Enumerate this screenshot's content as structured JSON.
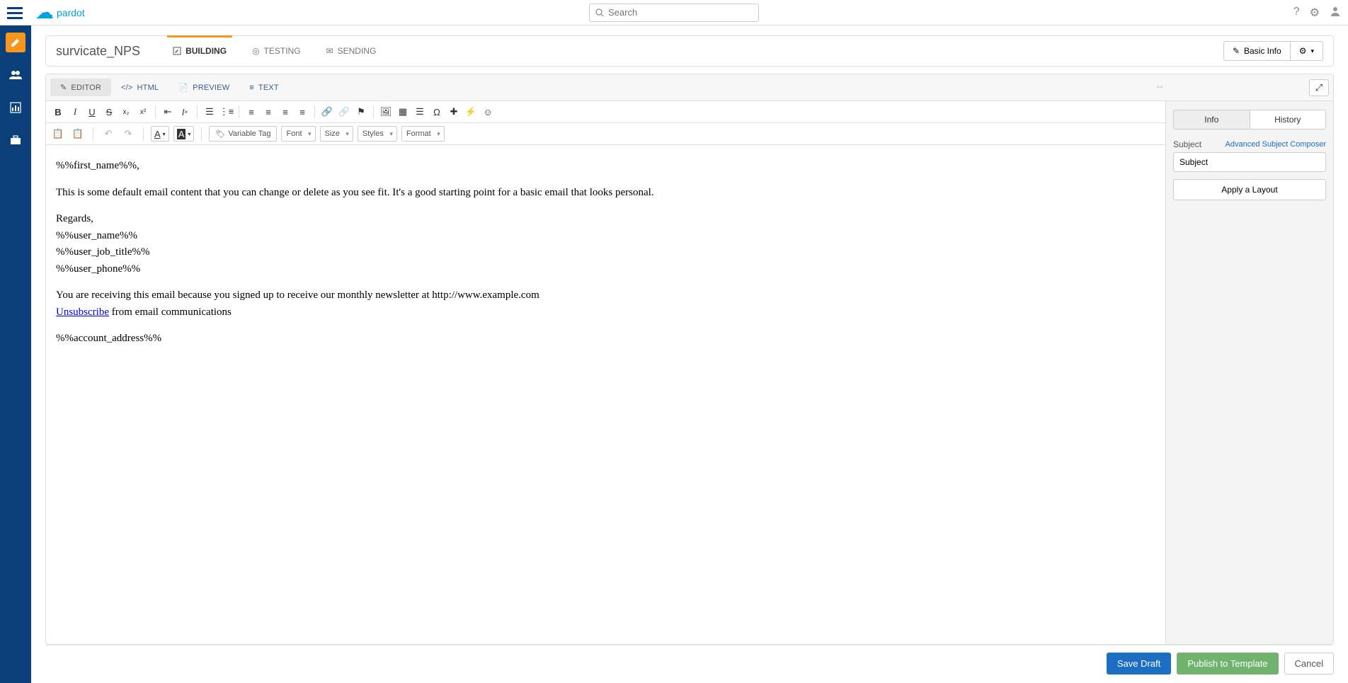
{
  "topbar": {
    "brand": "pardot",
    "search_placeholder": "Search"
  },
  "page": {
    "title": "survicate_NPS",
    "phases": [
      {
        "label": "BUILDING",
        "active": true
      },
      {
        "label": "TESTING",
        "active": false
      },
      {
        "label": "SENDING",
        "active": false
      }
    ],
    "basic_info": "Basic Info"
  },
  "viewtabs": [
    {
      "label": "EDITOR",
      "active": true
    },
    {
      "label": "HTML",
      "active": false
    },
    {
      "label": "PREVIEW",
      "active": false
    },
    {
      "label": "TEXT",
      "active": false
    }
  ],
  "toolbar": {
    "variable_tag": "Variable Tag",
    "font": "Font",
    "size": "Size",
    "styles": "Styles",
    "format": "Format"
  },
  "email": {
    "line1": "%%first_name%%,",
    "line2": "This is some default email content that you can change or delete as you see fit. It's a good starting point for a basic email that looks personal.",
    "line3": "Regards,",
    "line4": "%%user_name%%",
    "line5": "%%user_job_title%%",
    "line6": "%%user_phone%%",
    "line7a": "You are receiving this email because you signed up to receive our monthly newsletter at http://www.example.com",
    "unsub": "Unsubscribe",
    "line7b": " from email communications",
    "line8": "%%account_address%%"
  },
  "sidebar": {
    "tab_info": "Info",
    "tab_history": "History",
    "subject_label": "Subject",
    "subject_value": "Subject",
    "advanced": "Advanced Subject Composer",
    "apply_layout": "Apply a Layout"
  },
  "footer": {
    "save": "Save Draft",
    "publish": "Publish to Template",
    "cancel": "Cancel"
  }
}
